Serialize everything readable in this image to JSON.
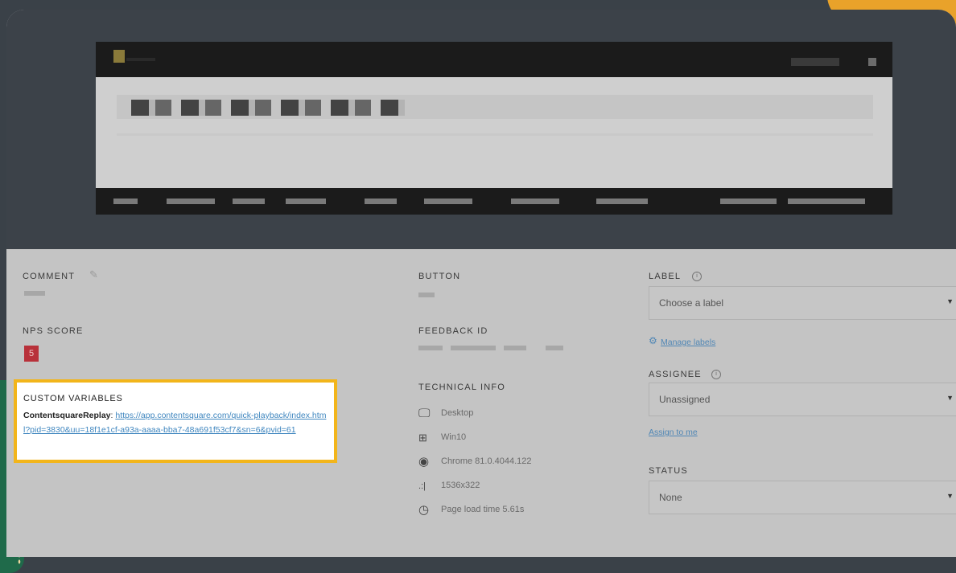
{
  "feedback": {
    "comment": {
      "label": "COMMENT"
    },
    "nps": {
      "label": "NPS SCORE",
      "value": "5"
    },
    "custom_variables": {
      "title": "CUSTOM VARIABLES",
      "key": "ContentsquareReplay",
      "url": "https://app.contentsquare.com/quick-playback/index.html?pid=3830&uu=18f1e1cf-a93a-aaaa-bba7-48a691f53cf7&sn=6&pvid=61"
    },
    "button": {
      "label": "BUTTON"
    },
    "feedback_id": {
      "label": "FEEDBACK ID"
    },
    "technical_info": {
      "label": "TECHNICAL INFO",
      "device": "Desktop",
      "os": "Win10",
      "browser": "Chrome 81.0.4044.122",
      "resolution": "1536x322",
      "load_time": "Page load time 5.61s"
    }
  },
  "sidebar": {
    "label": {
      "title": "LABEL",
      "selected": "Choose a label",
      "manage_link": "Manage labels"
    },
    "assignee": {
      "title": "ASSIGNEE",
      "selected": "Unassigned",
      "assign_link": "Assign to me"
    },
    "status": {
      "title": "STATUS",
      "selected": "None"
    }
  },
  "icons": {
    "edit": "pencil-icon",
    "info": "info-icon",
    "desktop": "monitor-icon",
    "os": "windows-icon",
    "browser": "chrome-icon",
    "resolution": "signal-bars-icon",
    "clock": "clock-icon",
    "caret": "caret-down-icon",
    "gear": "gear-icon"
  },
  "colors": {
    "highlight_border": "#f2b51b",
    "link": "#3f86bf",
    "nps_badge": "#b8313a"
  }
}
